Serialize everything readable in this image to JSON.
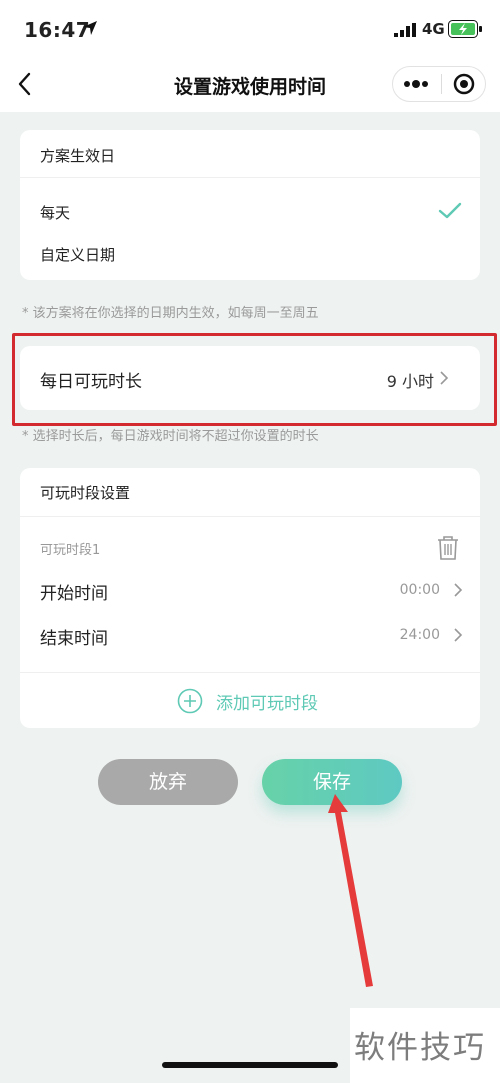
{
  "status_bar": {
    "time": "16:47",
    "network": "4G"
  },
  "nav": {
    "title": "设置游戏使用时间"
  },
  "effective_days": {
    "header": "方案生效日",
    "options": [
      {
        "label": "每天",
        "selected": true
      },
      {
        "label": "自定义日期",
        "selected": false
      }
    ],
    "note": "* 该方案将在你选择的日期内生效，如每周一至周五"
  },
  "daily_limit": {
    "label": "每日可玩时长",
    "value": "9 小时",
    "note": "* 选择时长后，每日游戏时间将不超过你设置的时长"
  },
  "periods": {
    "header": "可玩时段设置",
    "period_title": "可玩时段1",
    "start_label": "开始时间",
    "start_value": "00:00",
    "end_label": "结束时间",
    "end_value": "24:00",
    "add_label": "添加可玩时段"
  },
  "actions": {
    "abandon": "放弃",
    "save": "保存"
  },
  "watermark": "软件技巧",
  "colors": {
    "accent": "#5ec9b4",
    "highlight": "#d32a2f",
    "arrow": "#e63b3b"
  }
}
